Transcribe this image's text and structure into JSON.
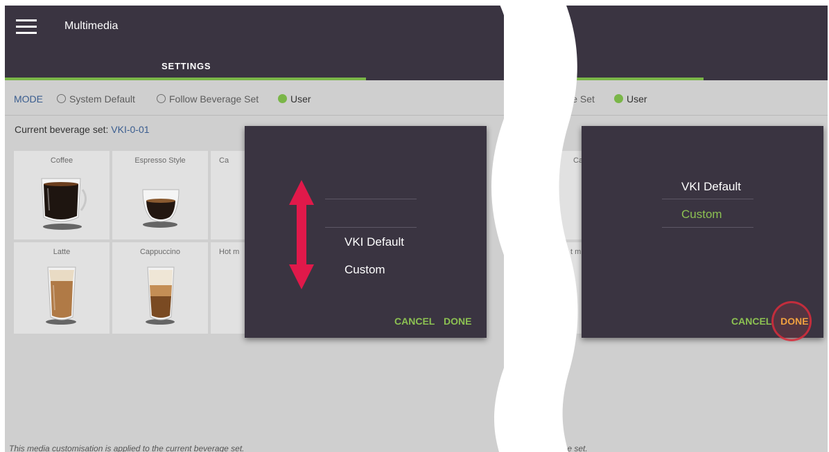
{
  "app": {
    "title": "Multimedia"
  },
  "tabs": {
    "active": "SETTINGS"
  },
  "mode": {
    "label": "MODE",
    "options": [
      "System Default",
      "Follow Beverage Set",
      "User"
    ],
    "selected": "User",
    "right_partial_follow": "rage Set"
  },
  "beverage_set": {
    "label": "Current beverage set:",
    "value": "VKI-0-01"
  },
  "beverages": [
    {
      "name": "Coffee"
    },
    {
      "name": "Espresso Style"
    },
    {
      "name": "Ca"
    },
    {
      "name": "Latte"
    },
    {
      "name": "Cappuccino"
    },
    {
      "name": "Hot m"
    }
  ],
  "right_partial_tiles": [
    "Ca",
    "t m"
  ],
  "dialog_left": {
    "options": [
      "VKI Default",
      "Custom"
    ],
    "cancel": "CANCEL",
    "done": "DONE"
  },
  "dialog_right": {
    "options": [
      "VKI Default",
      "Custom"
    ],
    "selected": "Custom",
    "cancel": "CANCEL",
    "done": "DONE"
  },
  "footer": {
    "text": "This media customisation is applied to the current beverage set.",
    "right_partial": "age set."
  },
  "colors": {
    "appbar": "#3a3441",
    "accent": "#7ab648",
    "dialog_text_selected": "#8cc152",
    "scroll_arrow": "#e0194a",
    "highlight": "#d72d3c"
  },
  "icons": [
    "hamburger-menu-icon",
    "scroll-up-down-arrow-icon",
    "tap-highlight-icon"
  ]
}
